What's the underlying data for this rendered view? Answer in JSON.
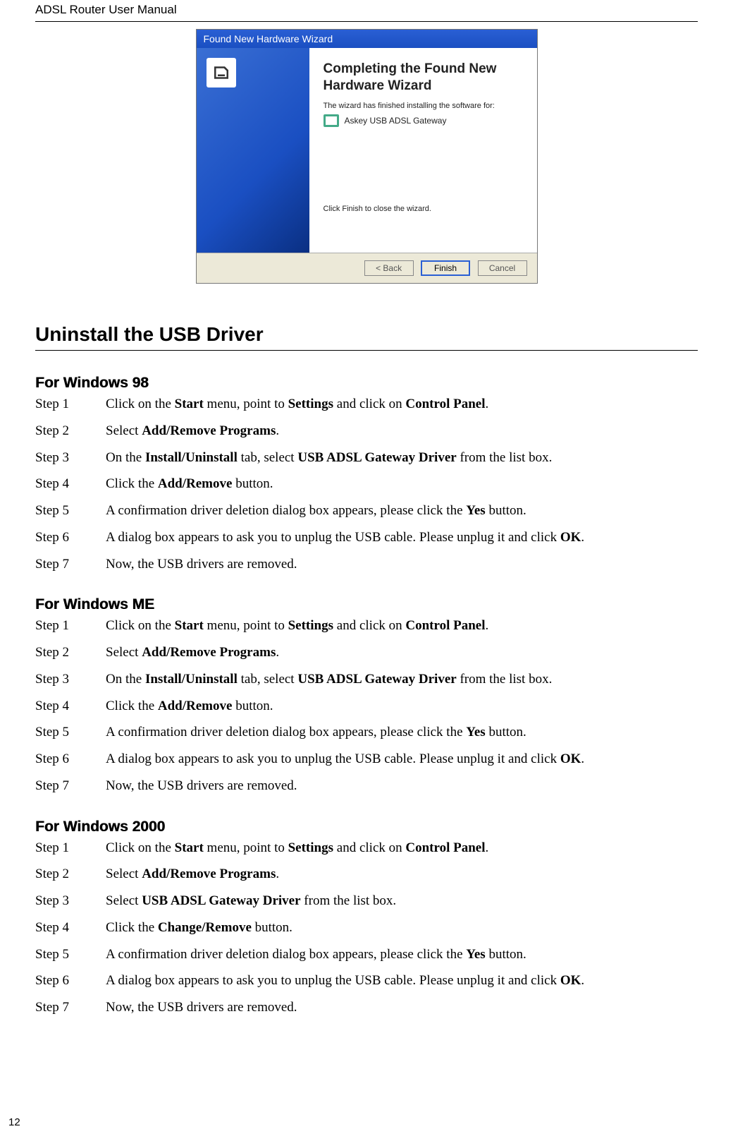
{
  "header": "ADSL Router User Manual",
  "page_number": "12",
  "wizard": {
    "title": "Found New Hardware Wizard",
    "heading": "Completing the Found New Hardware Wizard",
    "subtext": "The wizard has finished installing the software for:",
    "device": "Askey USB ADSL Gateway",
    "finish_note": "Click Finish to close the wizard.",
    "btn_back": "< Back",
    "btn_finish": "Finish",
    "btn_cancel": "Cancel"
  },
  "main_heading": "Uninstall the USB Driver",
  "sections": [
    {
      "heading": "For Windows 98",
      "steps": [
        {
          "label": "Step 1",
          "parts": [
            "Click on the ",
            {
              "b": "Start"
            },
            " menu, point to ",
            {
              "b": "Settings"
            },
            " and click on ",
            {
              "b": "Control Panel"
            },
            "."
          ]
        },
        {
          "label": "Step 2",
          "parts": [
            "Select ",
            {
              "b": "Add/Remove Programs"
            },
            "."
          ]
        },
        {
          "label": "Step 3",
          "parts": [
            "On the ",
            {
              "b": "Install/Uninstall"
            },
            " tab, select ",
            {
              "b": "USB ADSL Gateway Driver"
            },
            " from the list box."
          ]
        },
        {
          "label": "Step 4",
          "parts": [
            "Click the ",
            {
              "b": "Add/Remove"
            },
            " button."
          ]
        },
        {
          "label": "Step 5",
          "parts": [
            "A confirmation driver deletion dialog box appears, please click the ",
            {
              "b": "Yes"
            },
            " button."
          ]
        },
        {
          "label": "Step 6",
          "parts": [
            "A dialog box appears to ask you to unplug the USB cable. Please unplug it and click ",
            {
              "b": "OK"
            },
            "."
          ]
        },
        {
          "label": "Step 7",
          "parts": [
            "Now, the USB drivers are removed."
          ]
        }
      ]
    },
    {
      "heading": "For Windows ME",
      "steps": [
        {
          "label": "Step 1",
          "parts": [
            "Click on the ",
            {
              "b": "Start"
            },
            " menu, point to ",
            {
              "b": "Settings"
            },
            " and click on ",
            {
              "b": "Control Panel"
            },
            "."
          ]
        },
        {
          "label": "Step 2",
          "parts": [
            "Select ",
            {
              "b": "Add/Remove Programs"
            },
            "."
          ]
        },
        {
          "label": "Step 3",
          "parts": [
            "On the ",
            {
              "b": "Install/Uninstall"
            },
            " tab, select ",
            {
              "b": "USB ADSL Gateway Driver"
            },
            " from the list box."
          ]
        },
        {
          "label": "Step 4",
          "parts": [
            "Click the ",
            {
              "b": "Add/Remove"
            },
            " button."
          ]
        },
        {
          "label": "Step 5",
          "parts": [
            "A confirmation driver deletion dialog box appears, please click the ",
            {
              "b": "Yes"
            },
            " button."
          ]
        },
        {
          "label": "Step 6",
          "parts": [
            "A dialog box appears to ask you to unplug the USB cable. Please unplug it and click ",
            {
              "b": "OK"
            },
            "."
          ]
        },
        {
          "label": "Step 7",
          "parts": [
            "Now, the USB drivers are removed."
          ]
        }
      ]
    },
    {
      "heading": "For Windows 2000",
      "steps": [
        {
          "label": "Step 1",
          "parts": [
            "Click on the ",
            {
              "b": "Start"
            },
            " menu, point to ",
            {
              "b": "Settings"
            },
            " and click on ",
            {
              "b": "Control Panel"
            },
            "."
          ]
        },
        {
          "label": "Step 2",
          "parts": [
            "Select ",
            {
              "b": "Add/Remove Programs"
            },
            "."
          ]
        },
        {
          "label": "Step 3",
          "parts": [
            "Select ",
            {
              "b": "USB ADSL Gateway Driver"
            },
            " from the list box."
          ]
        },
        {
          "label": "Step 4",
          "parts": [
            "Click the ",
            {
              "b": "Change/Remove"
            },
            " button."
          ]
        },
        {
          "label": "Step 5",
          "parts": [
            "A confirmation driver deletion dialog box appears, please click the ",
            {
              "b": "Yes"
            },
            " button."
          ]
        },
        {
          "label": "Step 6",
          "parts": [
            "A dialog box appears to ask you to unplug the USB cable. Please unplug it and click ",
            {
              "b": "OK"
            },
            "."
          ]
        },
        {
          "label": "Step 7",
          "parts": [
            "Now, the USB drivers are removed."
          ]
        }
      ]
    }
  ]
}
